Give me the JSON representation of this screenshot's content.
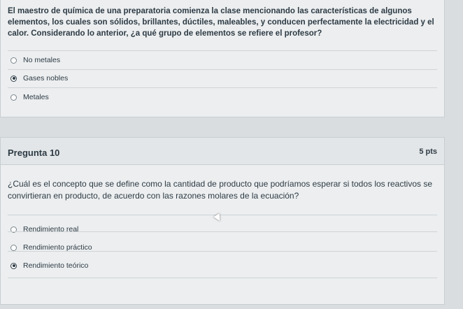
{
  "q9": {
    "text": "El maestro de química de una preparatoria comienza la clase mencionando las características de algunos elementos, los cuales son sólidos, brillantes, dúctiles, maleables, y conducen perfectamente la electricidad y el calor. Considerando lo anterior, ¿a qué grupo de elementos se refiere el profesor?",
    "options": [
      {
        "label": "No metales",
        "selected": false
      },
      {
        "label": "Gases nobles",
        "selected": true
      },
      {
        "label": "Metales",
        "selected": false
      }
    ]
  },
  "q10": {
    "title": "Pregunta 10",
    "points": "5 pts",
    "text": "¿Cuál es el concepto que se define como la cantidad de producto que podríamos esperar si todos los reactivos se convirtieran en producto, de acuerdo con las razones molares de la ecuación?",
    "options": [
      {
        "label": "Rendimiento real",
        "selected": false
      },
      {
        "label": "Rendimiento práctico",
        "selected": false
      },
      {
        "label": "Rendimiento teórico",
        "selected": true
      }
    ]
  }
}
